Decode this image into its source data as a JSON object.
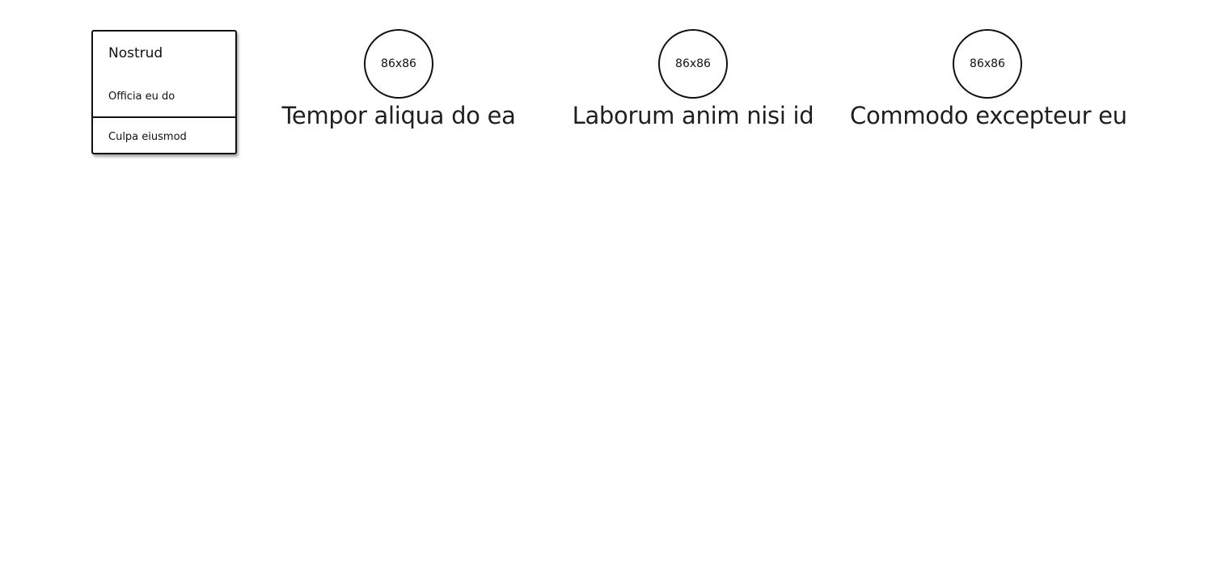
{
  "menu": {
    "header": "Nostrud",
    "item1": "Officia eu do",
    "item2": "Culpa eiusmod"
  },
  "profiles": [
    {
      "avatar_label": "86x86",
      "name": "Tempor aliqua do ea"
    },
    {
      "avatar_label": "86x86",
      "name": "Laborum anim nisi id"
    },
    {
      "avatar_label": "86x86",
      "name": "Commodo excepteur eu"
    }
  ]
}
